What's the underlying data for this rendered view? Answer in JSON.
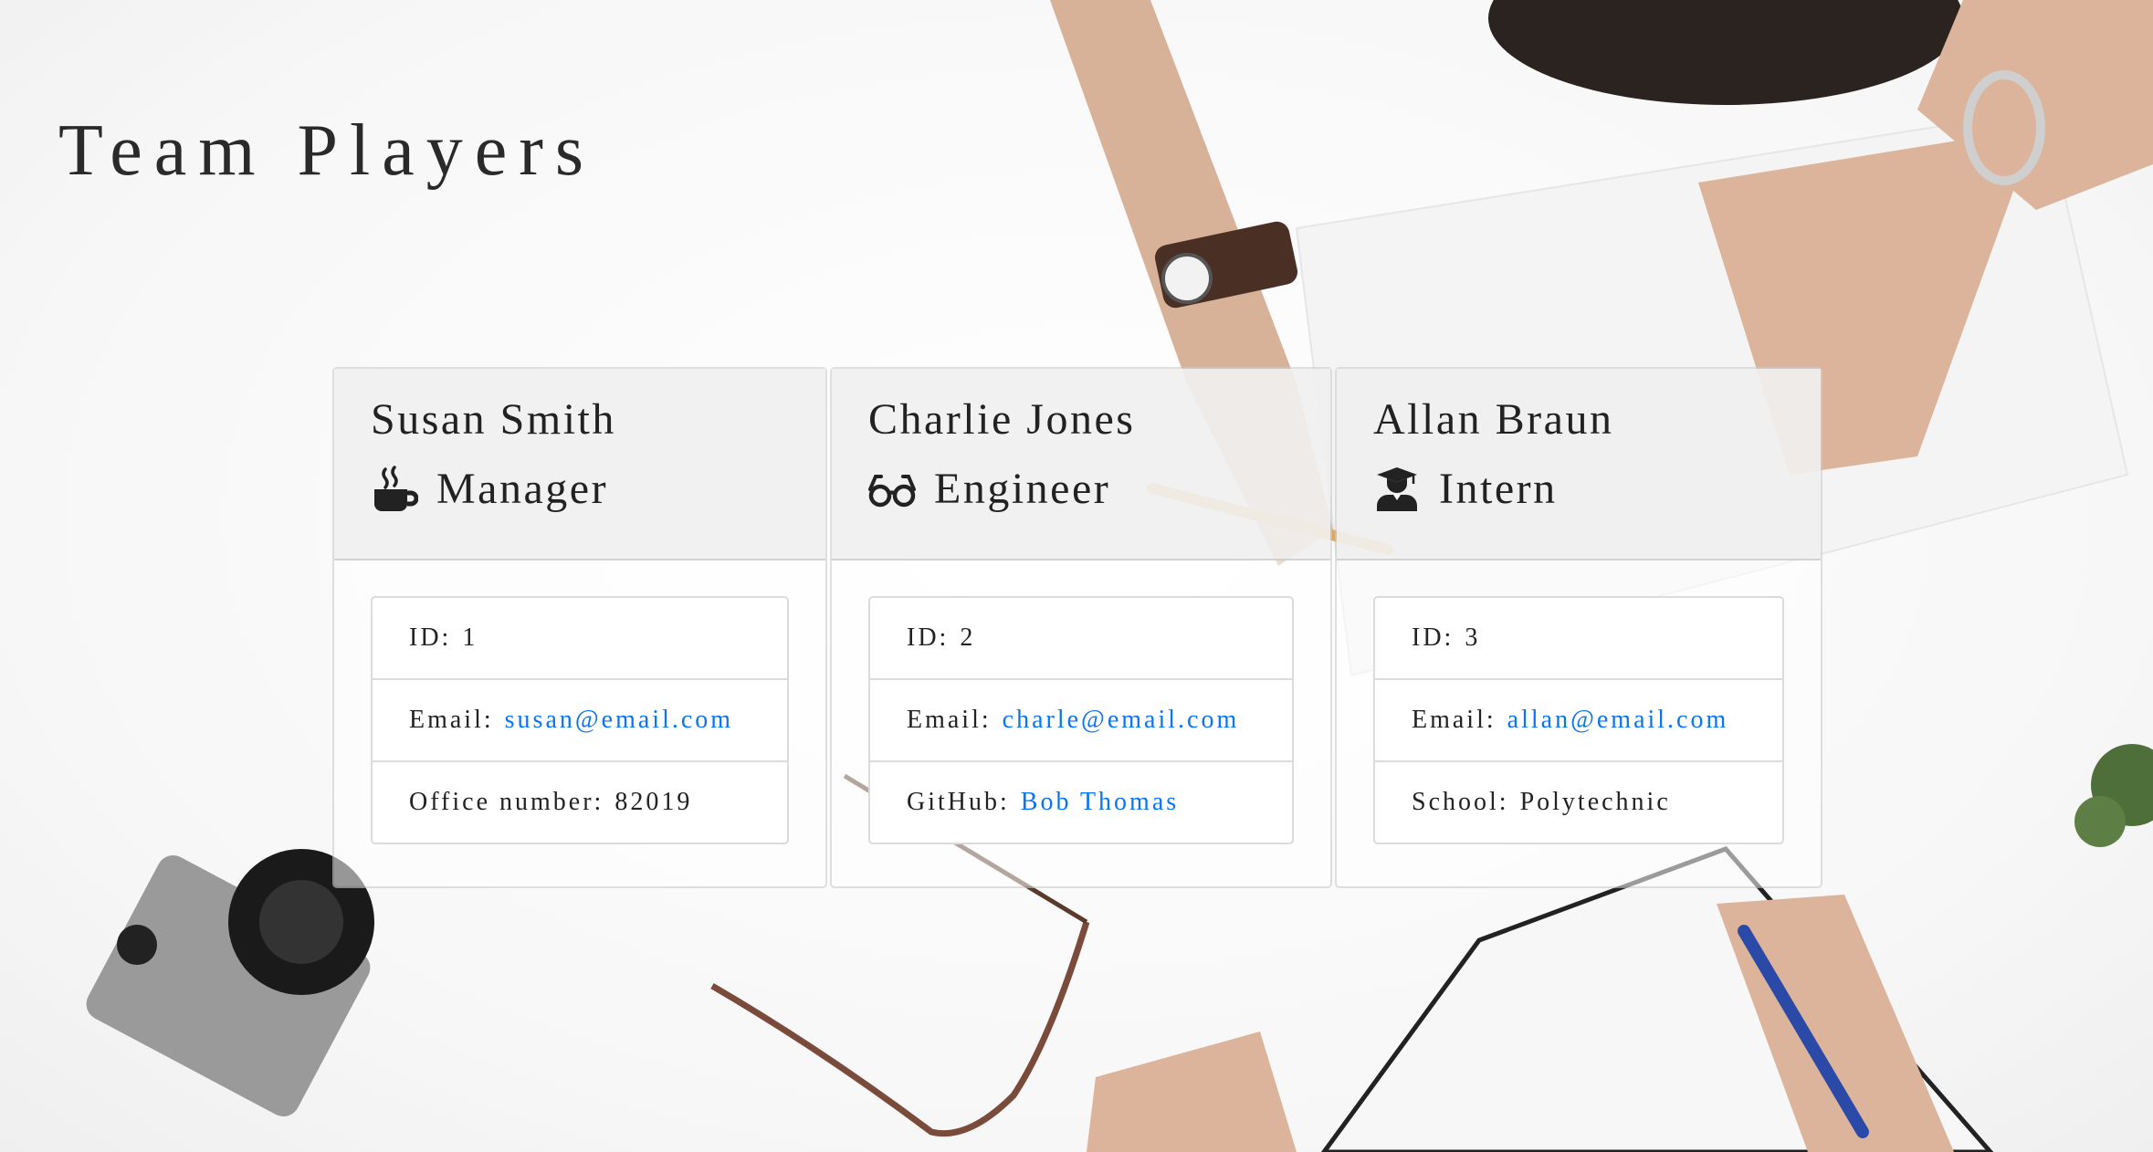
{
  "page": {
    "title": "Team Players"
  },
  "team": [
    {
      "name": "Susan Smith",
      "role": "Manager",
      "role_icon": "mug-hot-icon",
      "details": [
        {
          "label": "ID:",
          "value": "1",
          "is_link": false
        },
        {
          "label": "Email:",
          "value": "susan@email.com",
          "is_link": true
        },
        {
          "label": "Office number:",
          "value": "82019",
          "is_link": false
        }
      ]
    },
    {
      "name": "Charlie Jones",
      "role": "Engineer",
      "role_icon": "glasses-icon",
      "details": [
        {
          "label": "ID:",
          "value": "2",
          "is_link": false
        },
        {
          "label": "Email:",
          "value": "charle@email.com",
          "is_link": true
        },
        {
          "label": "GitHub:",
          "value": "Bob Thomas",
          "is_link": true
        }
      ]
    },
    {
      "name": "Allan Braun",
      "role": "Intern",
      "role_icon": "user-graduate-icon",
      "details": [
        {
          "label": "ID:",
          "value": "3",
          "is_link": false
        },
        {
          "label": "Email:",
          "value": "allan@email.com",
          "is_link": true
        },
        {
          "label": "School:",
          "value": "Polytechnic",
          "is_link": false
        }
      ]
    }
  ],
  "colors": {
    "link": "#0a74f5",
    "header_bg": "#eeeeee",
    "text": "#222222"
  }
}
